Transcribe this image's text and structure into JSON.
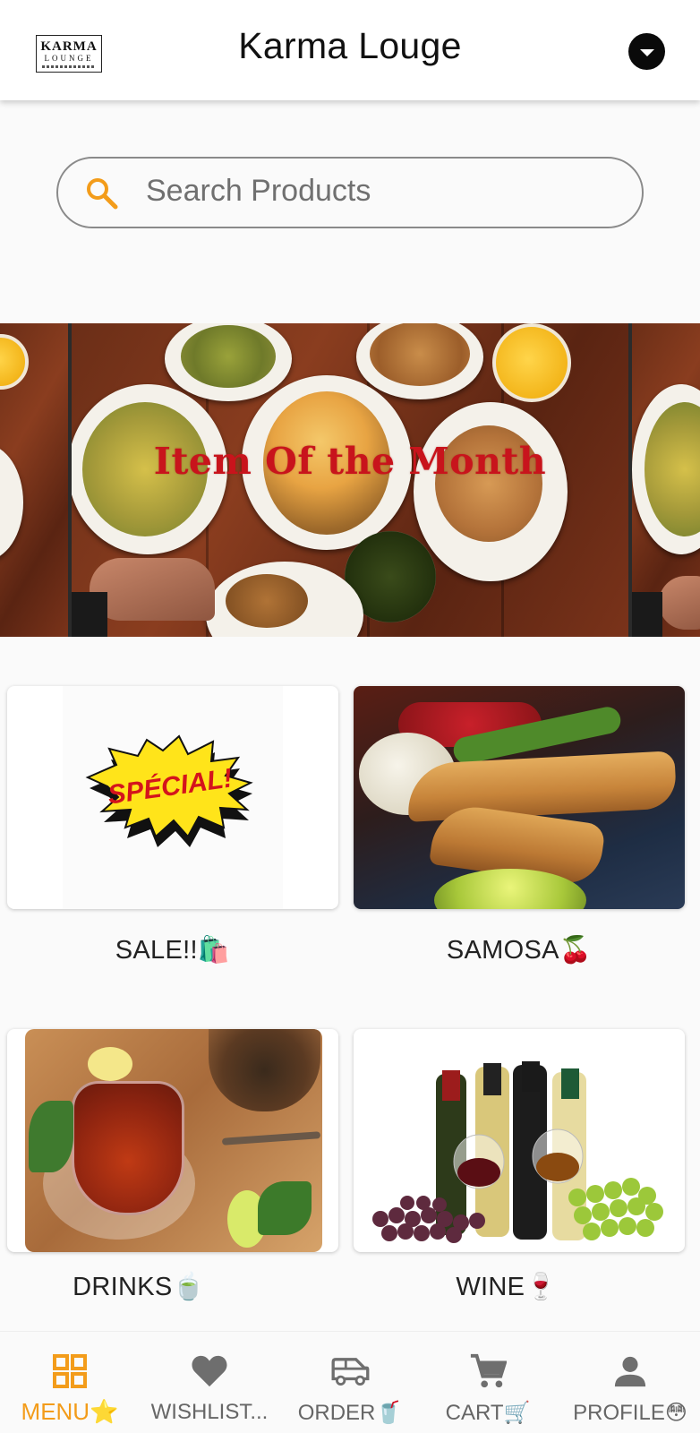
{
  "header": {
    "logo_line1": "KARMA",
    "logo_line2": "LOUNGE",
    "title": "Karma Louge",
    "menu_icon": "dropdown-arrow-icon"
  },
  "search": {
    "placeholder": "Search Products",
    "icon": "search-icon"
  },
  "banner": {
    "text": "Item Of the Month"
  },
  "categories": [
    {
      "label": "SALE!!🛍️",
      "image_text": "SPÉCIAL!"
    },
    {
      "label": "SAMOSA🍒"
    },
    {
      "label": "DRINKS🍵"
    },
    {
      "label": "WINE🍷"
    }
  ],
  "bottom_nav": [
    {
      "label": "MENU⭐",
      "icon": "menu-grid-icon",
      "active": true
    },
    {
      "label": "WISHLIST...",
      "icon": "heart-icon",
      "active": false
    },
    {
      "label": "ORDER🥤",
      "icon": "delivery-van-icon",
      "active": false
    },
    {
      "label": "CART🛒",
      "icon": "cart-icon",
      "active": false
    },
    {
      "label": "PROFILE😳",
      "icon": "person-icon",
      "active": false
    }
  ],
  "colors": {
    "accent": "#f39c1a",
    "banner_text": "#c8141c",
    "inactive_nav": "#666666"
  }
}
